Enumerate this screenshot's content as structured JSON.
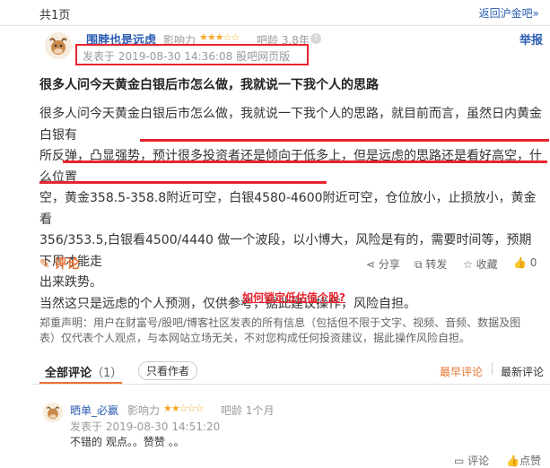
{
  "header": {
    "page_count": "共1页",
    "back_link": "返回沪金吧»"
  },
  "post": {
    "author": "围脖也是远虑",
    "influence_label": "影响力",
    "influence_stars": "★★★☆☆",
    "age_label": "吧龄 3.8年",
    "report": "举报",
    "post_time": "发表于 2019-08-30 14:36:08 股吧网页版",
    "title": "很多人问今天黄金白银后市怎么做，我就说一下我个人的思路",
    "lines": [
      "很多人问今天黄金白银后市怎么做，我就说一下我个人的思路，就目前而言，虽然日内黄金白银有",
      "所反弹，凸显强势，预计很多投资者还是倾向于低多上，但是远虑的思路还是看好高空，什么位置",
      "空，黄金358.5-358.8附近可空，白银4580-4600附近可空，仓位放小，止损放小，黄金看",
      "356/353.5,白银看4500/4440 做一个波段，以小博大，风险是有的，需要时间等，预期下周才能走",
      "出来跌势。",
      "当然这只是远虑的个人预测，仅供参考，据此建议操作，风险自担。"
    ],
    "comment_label": "评论",
    "share_label": "分享",
    "repost_label": "转发",
    "collect_label": "收藏",
    "like_count": "0"
  },
  "promo": {
    "lock_link": "如何锁定低估值个股?"
  },
  "disclaimer": {
    "line1": "郑重声明：用户在财富号/股吧/博客社区发表的所有信息（包括但不限于文字、视频、音频、数据及图",
    "line2": "表）仅代表个人观点，与本网站立场无关，不对您构成任何投资建议，据此操作风险自担。"
  },
  "comments_section": {
    "tab_all": "全部评论",
    "tab_count": "（1）",
    "author_only": "只看作者",
    "sort_early": "最早评论",
    "sort_new": "最新评论"
  },
  "comments": [
    {
      "author": "晒单_必赢",
      "influence_label": "影响力",
      "influence_stars": "★★☆☆☆",
      "age_label": "吧龄 1个月",
      "time": "发表于 2019-08-30 14:51:20",
      "text": "不错的 观点。。赞赞 。。",
      "reply_label": "评论",
      "like_label": "点赞"
    }
  ],
  "colors": {
    "accent": "#e8732f",
    "link": "#2a5db0",
    "highlight": "#e8232f"
  }
}
